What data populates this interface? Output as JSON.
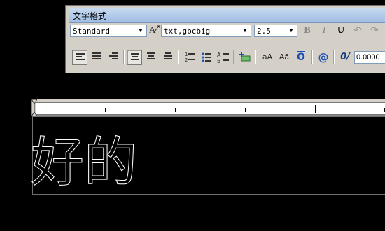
{
  "window": {
    "title": "文字格式"
  },
  "row1": {
    "style_value": "Standard",
    "font_value": "txt,gbcbig",
    "height_value": "2.5",
    "bold_label": "B",
    "italic_label": "I",
    "underline_label": "U",
    "undo_label": "↶",
    "redo_label": "↷"
  },
  "row2": {
    "stack_numbered": "1",
    "stack_bullets": "•",
    "stack_lettered": "A",
    "upper_label": "aA",
    "lower_label": "Aā",
    "overline_label": "O",
    "symbol_label": "@",
    "oblique_label": "0/",
    "oblique_value": "0.0000"
  },
  "editor": {
    "text": "好的"
  },
  "colors": {
    "title_gradient_top": "#c6d9ef",
    "title_gradient_bottom": "#9fbde4",
    "panel": "#d4d0c8",
    "canvas": "#000000",
    "text": "#ffffff"
  }
}
